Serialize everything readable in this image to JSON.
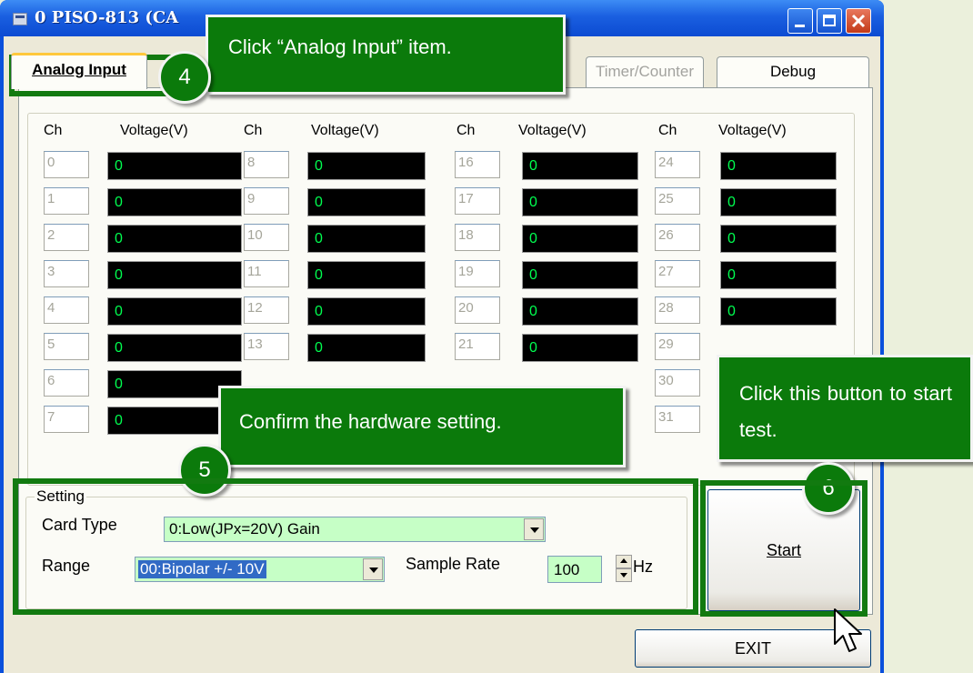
{
  "window": {
    "title": "0 PISO-813 (CA"
  },
  "tabs": [
    {
      "label": "Analog Input",
      "state": "active"
    },
    {
      "label": "Timer/Counter",
      "state": "disabled"
    },
    {
      "label": "Debug",
      "state": "normal"
    }
  ],
  "table": {
    "ch_header": "Ch",
    "voltage_header": "Voltage(V)",
    "columns": [
      {
        "channels": [
          "0",
          "1",
          "2",
          "3",
          "4",
          "5",
          "6",
          "7"
        ],
        "voltages": [
          "0",
          "0",
          "0",
          "0",
          "0",
          "0",
          "0",
          "0"
        ]
      },
      {
        "channels": [
          "8",
          "9",
          "10",
          "11",
          "12",
          "13"
        ],
        "voltages": [
          "0",
          "0",
          "0",
          "0",
          "0",
          "0"
        ]
      },
      {
        "channels": [
          "16",
          "17",
          "18",
          "19",
          "20",
          "21"
        ],
        "voltages": [
          "0",
          "0",
          "0",
          "0",
          "0",
          "0"
        ]
      },
      {
        "channels": [
          "24",
          "25",
          "26",
          "27",
          "28",
          "29",
          "30",
          "31"
        ],
        "voltages": [
          "0",
          "0",
          "0",
          "0",
          "0"
        ]
      }
    ]
  },
  "setting": {
    "group_label": "Setting",
    "card_type_label": "Card Type",
    "card_type_value": "0:Low(JPx=20V) Gain",
    "range_label": "Range",
    "range_value": "00:Bipolar +/- 10V",
    "sample_rate_label": "Sample Rate",
    "sample_rate_value": "100",
    "sample_rate_unit": "Hz"
  },
  "buttons": {
    "start": "Start",
    "exit": "EXIT"
  },
  "annotations": {
    "step4": {
      "number": "4",
      "text": "Click “Analog Input” item."
    },
    "step5": {
      "number": "5",
      "text": "Confirm the hardware setting."
    },
    "step6": {
      "number": "6",
      "text": "Click this button to start test."
    }
  },
  "colors": {
    "annotation_green": "#0b7a0b",
    "voltage_text": "#00ff50",
    "combo_bg": "#c6ffc6"
  }
}
